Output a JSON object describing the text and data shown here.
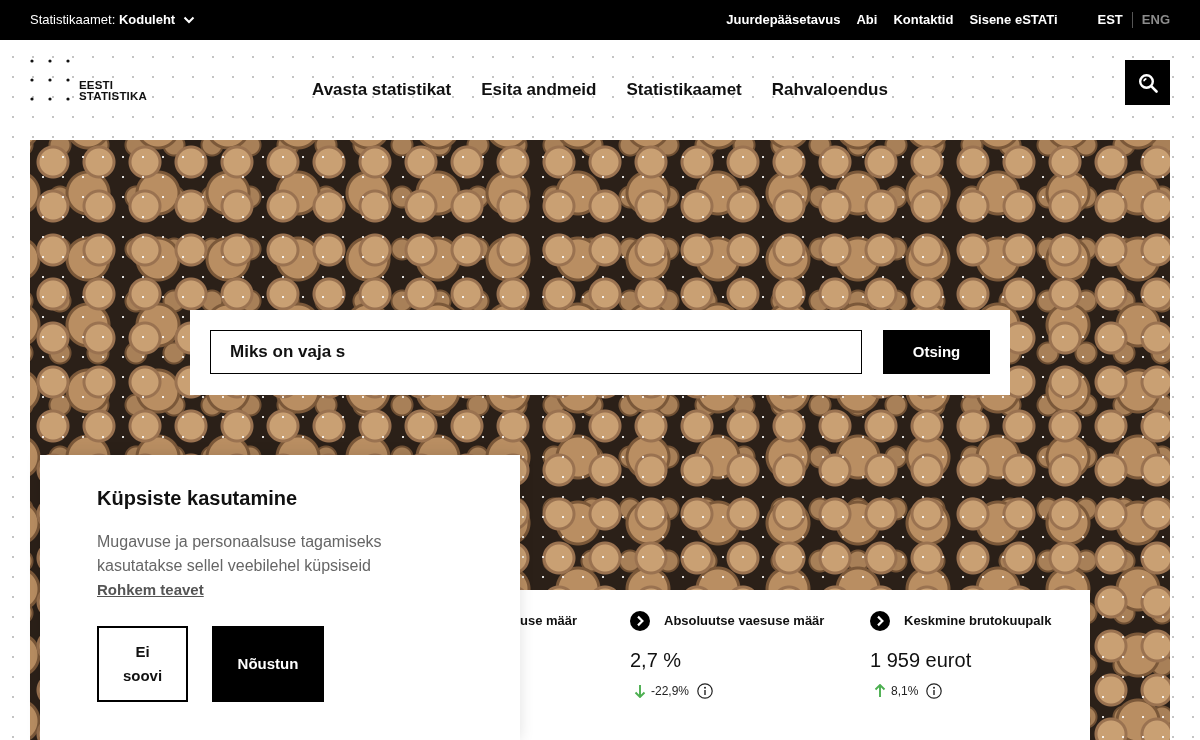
{
  "top_bar": {
    "site_selector": "Statistikaamet: **Koduleht**",
    "links": [
      "Juurdepääsetavus",
      "Abi",
      "Kontaktid",
      "Sisene eSTATi"
    ],
    "languages": [
      {
        "label": "EST",
        "selected": true
      },
      {
        "label": "ENG",
        "selected": false
      }
    ]
  },
  "header": {
    "logo_text": "EESTI STATISTIKA",
    "nav": [
      "Avasta statistikat",
      "Esita andmeid",
      "Statistikaamet",
      "Rahvaloendus"
    ]
  },
  "search": {
    "value": "Miks on vaja s",
    "button": "Otsing"
  },
  "stats": [
    {
      "kind": "title_only",
      "title": "use määr"
    },
    {
      "kind": "full",
      "title": "Absoluutse vaesuse määr",
      "value": "2,7 %",
      "change": "-22,9%",
      "rising": false
    },
    {
      "kind": "full",
      "title": "Keskmine brutokuupalk",
      "value": "1 959 eurot",
      "change": "8,1%",
      "rising": true
    }
  ],
  "cookie_notice": {
    "title": "Küpsiste kasutamine",
    "text": "Mugavuse ja personaalsuse tagamiseks kasutatakse sellel veebilehel küpsiseid",
    "link": "Rohkem teavet",
    "buttons": [
      {
        "label": "Ei soovi",
        "kind": "outline"
      },
      {
        "label": "Nõustun",
        "kind": "filled"
      }
    ]
  }
}
